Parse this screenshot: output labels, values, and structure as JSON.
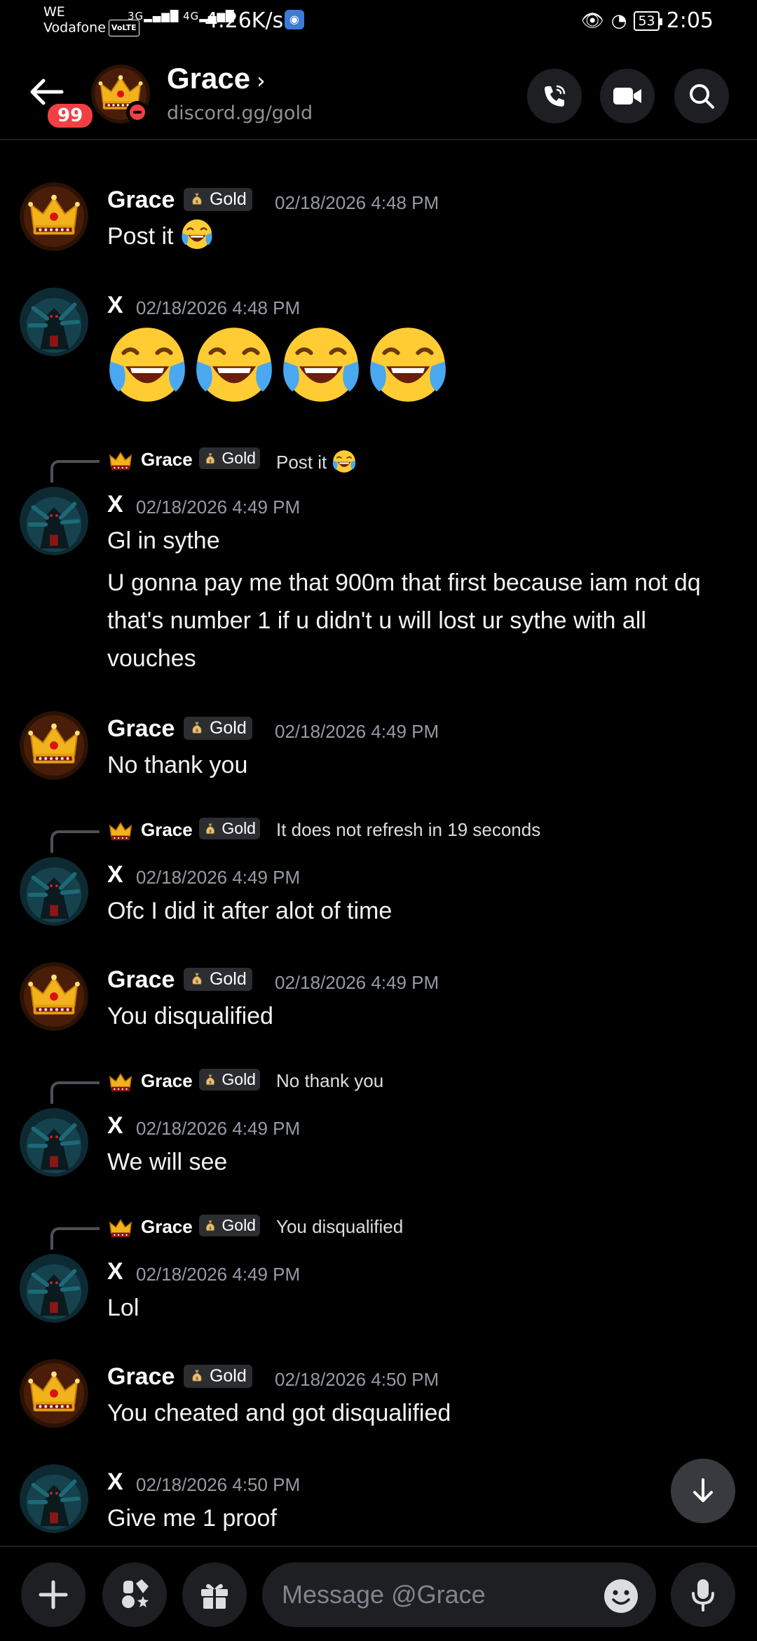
{
  "status_bar": {
    "carrier_line1": "WE",
    "carrier_line2": "Vodafone",
    "volte": "VoLTE",
    "signal_1": "3G",
    "signal_2": "4G",
    "net_speed": "4.26K/s",
    "battery": "53",
    "time": "2:05"
  },
  "header": {
    "unread_badge": "99",
    "name": "Grace",
    "subtitle": "discord.gg/gold",
    "chevron": "›"
  },
  "messages": [
    {
      "author": "Grace",
      "role": "Gold",
      "timestamp": "02/18/2026 4:48 PM",
      "text": "Post it"
    },
    {
      "author": "X",
      "timestamp": "02/18/2026 4:48 PM"
    },
    {
      "reply_author": "Grace",
      "reply_role": "Gold",
      "reply_text": "Post it",
      "author": "X",
      "timestamp": "02/18/2026 4:49 PM",
      "text": "Gl in sythe",
      "text2": "U gonna pay me that 900m that first because iam not dq that's number 1 if u didn't u will lost ur sythe with all vouches"
    },
    {
      "author": "Grace",
      "role": "Gold",
      "timestamp": "02/18/2026 4:49 PM",
      "text": "No thank you"
    },
    {
      "reply_author": "Grace",
      "reply_role": "Gold",
      "reply_text": "It does not refresh in 19 seconds",
      "author": "X",
      "timestamp": "02/18/2026 4:49 PM",
      "text": "Ofc I did it after alot of time"
    },
    {
      "author": "Grace",
      "role": "Gold",
      "timestamp": "02/18/2026 4:49 PM",
      "text": "You disqualified"
    },
    {
      "reply_author": "Grace",
      "reply_role": "Gold",
      "reply_text": "No thank you",
      "author": "X",
      "timestamp": "02/18/2026 4:49 PM",
      "text": "We will see"
    },
    {
      "reply_author": "Grace",
      "reply_role": "Gold",
      "reply_text": "You disqualified",
      "author": "X",
      "timestamp": "02/18/2026 4:49 PM",
      "text": "Lol"
    },
    {
      "author": "Grace",
      "role": "Gold",
      "timestamp": "02/18/2026 4:50 PM",
      "text": "You cheated and got disqualified"
    },
    {
      "author": "X",
      "timestamp": "02/18/2026 4:50 PM",
      "text": "Give me 1 proof"
    }
  ],
  "composer": {
    "placeholder": "Message @Grace"
  },
  "colors": {
    "background": "#000000",
    "dnd_red": "#f23f43",
    "timestamp_gray": "#949ba4",
    "button_bg": "#1e1f22"
  }
}
